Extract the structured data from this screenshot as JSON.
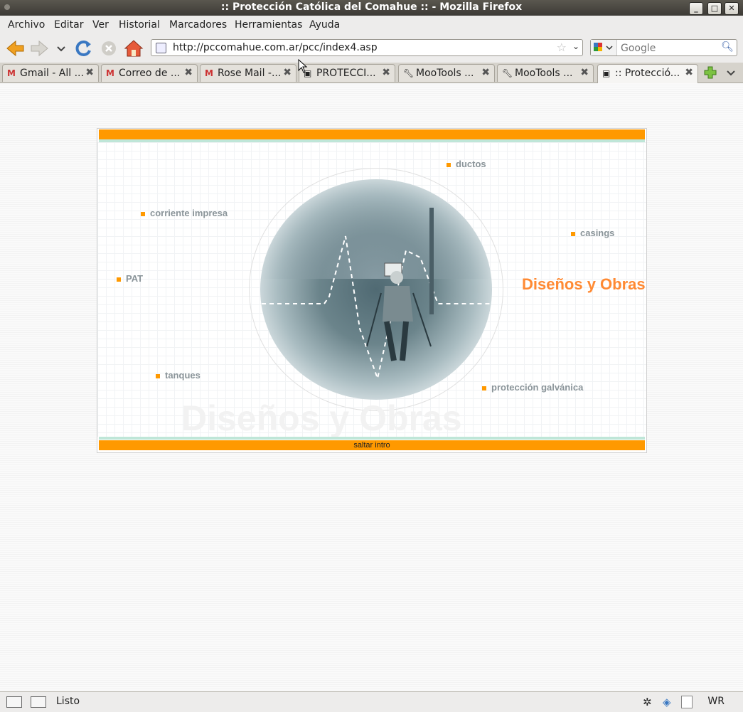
{
  "window": {
    "title": ":: Protección Católica del Comahue :: - Mozilla Firefox"
  },
  "menu": {
    "items": [
      "Archivo",
      "Editar",
      "Ver",
      "Historial",
      "Marcadores",
      "Herramientas",
      "Ayuda"
    ]
  },
  "navbar": {
    "url": "http://pccomahue.com.ar/pcc/index4.asp",
    "search_placeholder": "Google"
  },
  "tabs": [
    {
      "label": "Gmail - All ...",
      "icon": "gmail-icon"
    },
    {
      "label": "Correo de ...",
      "icon": "gmail-icon"
    },
    {
      "label": "Rose Mail -...",
      "icon": "gmail-icon"
    },
    {
      "label": "PROTECCI...",
      "icon": "page-icon"
    },
    {
      "label": "MooTools ...",
      "icon": "wrench-icon"
    },
    {
      "label": "MooTools ...",
      "icon": "wrench-icon"
    },
    {
      "label": ":: Protecció...",
      "icon": "page-icon",
      "active": true
    }
  ],
  "intro": {
    "links": {
      "ductos": "ductos",
      "corriente_impresa": "corriente impresa",
      "casings": "casings",
      "pat": "PAT",
      "tanques": "tanques",
      "proteccion_galvanica": "protección galvánica"
    },
    "heading": "Diseños y Obras",
    "watermark": "Diseños y Obras",
    "skip_label": "saltar intro"
  },
  "status": {
    "text": "Listo",
    "indicator": "WR"
  },
  "colors": {
    "accent_orange": "#ff9900",
    "heading_orange": "#ff8a33",
    "mint_stripe": "#bfe6d8"
  }
}
